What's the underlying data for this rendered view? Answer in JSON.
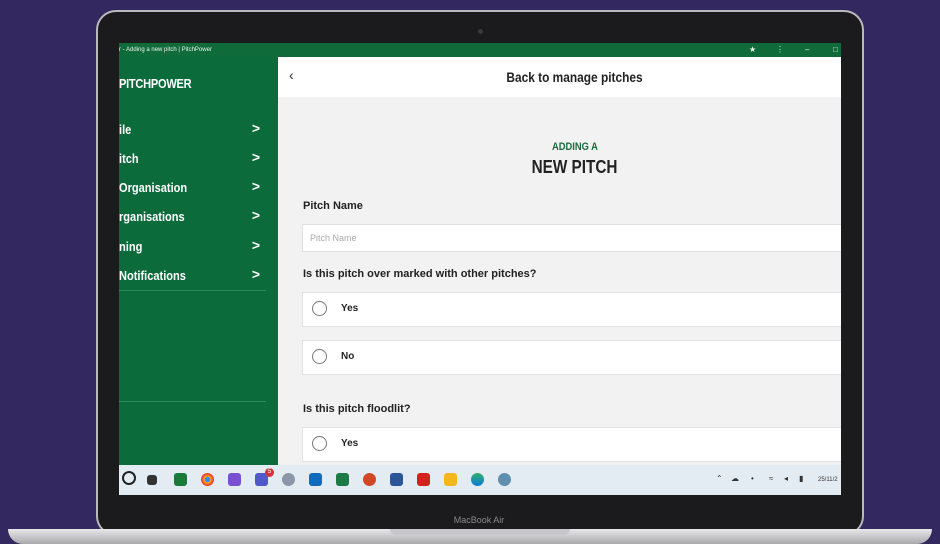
{
  "device": {
    "brand": "MacBook Air"
  },
  "window": {
    "title": "r - Adding a new pitch | PitchPower",
    "controls": [
      "pin-icon",
      "kebab-menu-icon",
      "minimize-icon",
      "restore-icon"
    ]
  },
  "sidebar": {
    "logo": "PITCHPOWER",
    "items": [
      {
        "label": "ile"
      },
      {
        "label": "itch"
      },
      {
        "label": " Organisation"
      },
      {
        "label": "rganisations"
      },
      {
        "label": "ning"
      },
      {
        "label": "Notifications"
      }
    ],
    "chevron": ">"
  },
  "topbar": {
    "back_icon": "‹",
    "title": "Back to manage pitches"
  },
  "form": {
    "heading_small": "ADDING A",
    "heading_big": "NEW PITCH",
    "pitch_name_label": "Pitch Name",
    "pitch_name_placeholder": "Pitch Name",
    "q_overmarked": "Is this pitch over marked with other pitches?",
    "q_overmarked_options": [
      "Yes",
      "No"
    ],
    "q_floodlit": "Is this pitch floodlit?",
    "q_floodlit_options": [
      "Yes"
    ]
  },
  "taskbar": {
    "icons": [
      "search-icon",
      "task-view-icon",
      "app-green-icon",
      "chrome-icon",
      "app-purple-icon",
      "teams-icon",
      "settings-icon",
      "outlook-icon",
      "excel-icon",
      "powerpoint-icon",
      "word-icon",
      "acrobat-icon",
      "file-explorer-icon",
      "edge-icon",
      "app-globe-icon"
    ],
    "teams_badge": "5",
    "tray_date": "25/11/2",
    "colors": {
      "accent": "#0b6b3a",
      "heading_green": "#1a6b3c",
      "background": "#342860"
    }
  }
}
